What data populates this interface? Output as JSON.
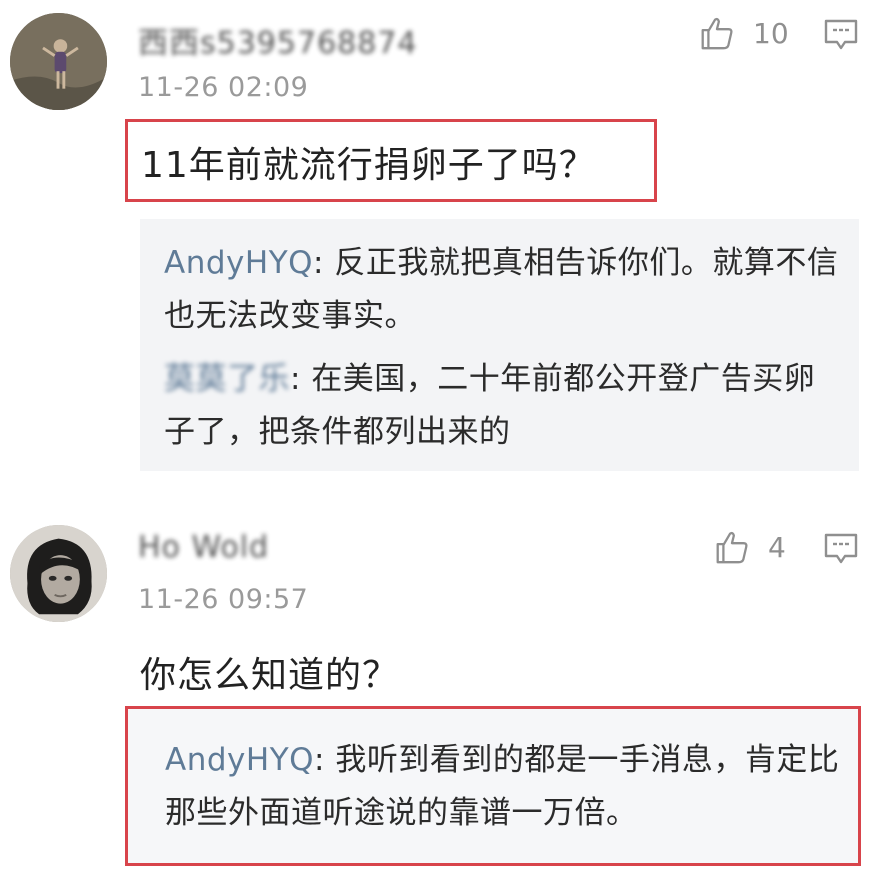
{
  "comments": [
    {
      "username": "西西s5395768874",
      "time": "11-26 02:09",
      "likes": "10",
      "content": "11年前就流行捐卵子了吗？",
      "replies": [
        {
          "author": "AndyHYQ",
          "text": "反正我就把真相告诉你们。就算不信也无法改变事实。"
        },
        {
          "author": "莫莫了乐",
          "text": "在美国，二十年前都公开登广告买卵子了，把条件都列出来的"
        }
      ]
    },
    {
      "username": "Ho Wold",
      "time": "11-26 09:57",
      "likes": "4",
      "content": "你怎么知道的？",
      "replies": [
        {
          "author": "AndyHYQ",
          "text": "我听到看到的都是一手消息，肯定比那些外面道听途说的靠谱一万倍。"
        }
      ]
    }
  ],
  "icons": {
    "like": "thumbs-up-icon",
    "reply": "comment-icon"
  },
  "colors": {
    "highlight": "#d8444b",
    "reply_author": "#5f7b97",
    "meta": "#9a9a9a"
  }
}
